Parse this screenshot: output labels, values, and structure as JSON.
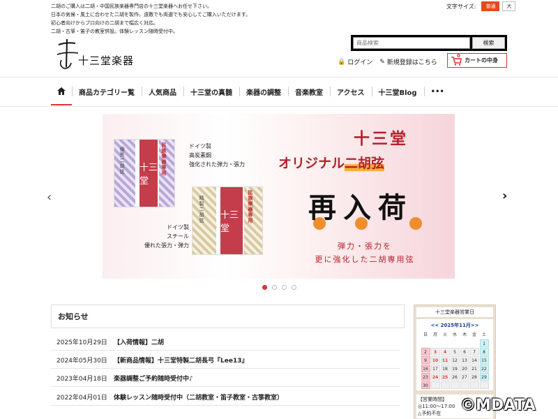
{
  "header": {
    "notes": [
      "二胡のご購入は二胡・中国民族楽器専門店の十三堂楽器へお任せ下さい。",
      "日本の気候・風土に合わせた二胡を製作。遠敷でも両選でも安心してご購入いただけます。",
      "初心者向けからプロ向けの二胡まで幅広く対応。",
      "二胡・古箏・笛子の教室併設。体験レッスン随時受付中。"
    ],
    "font_size_label": "文字サイズ:",
    "font_size_normal": "普通",
    "font_size_large": "大",
    "logo_text": "十三堂楽器",
    "search_placeholder": "商品検索",
    "search_button": "検索",
    "login": "ログイン",
    "register": "新規登録はこちら",
    "cart_label": "カートの中身",
    "cart_count": "0"
  },
  "nav": {
    "items": [
      "商品カテゴリー覧",
      "人気商品",
      "十三堂の真髄",
      "楽器の調整",
      "音楽教室",
      "アクセス",
      "十三堂Blog"
    ],
    "more": "•••"
  },
  "banner": {
    "title_line1": "十三堂",
    "title_line2_prefix": "オリジナル",
    "title_line2_highlight": "二胡弦",
    "headline": "再入荷",
    "sub_line1": "弾力・張力を",
    "sub_line2": "更に強化した二胡専用弦",
    "label_top": [
      "ドイツ製",
      "高炭素鋼",
      "強化された弾力・張力"
    ],
    "label_bottom": [
      "ドイツ製",
      "スチール",
      "優れた張力・弾力"
    ],
    "pack_text": "十三堂",
    "pack_side": "民族樂器専用",
    "pack_vert_left": "優秀二胡弦",
    "pack_vert_right": "精製二胡弦",
    "slide_count": 4,
    "active_slide": 0
  },
  "news": {
    "heading": "お知らせ",
    "items": [
      {
        "date": "2025年10月29日",
        "title": "【入荷情報】二胡"
      },
      {
        "date": "2024年05月30日",
        "title": "【新商品情報】十三堂特製二胡長弓『Lee13』"
      },
      {
        "date": "2023年04月18日",
        "title": "楽器調整ご予約随時受付中♪"
      },
      {
        "date": "2022年04月01日",
        "title": "体験レッスン随時受付中（二胡教室・笛子教室・古箏教室）"
      }
    ]
  },
  "calendar": {
    "title": "十三堂楽器営業日",
    "month": "<< 2025年11月>>",
    "weekdays": [
      "日",
      "月",
      "火",
      "水",
      "木",
      "金",
      "土"
    ],
    "hours_title": "【営業時間】",
    "hours_line1": "◎11:00〜17:00",
    "hours_line2": "△予約不在"
  },
  "watermark": "©MDATA"
}
